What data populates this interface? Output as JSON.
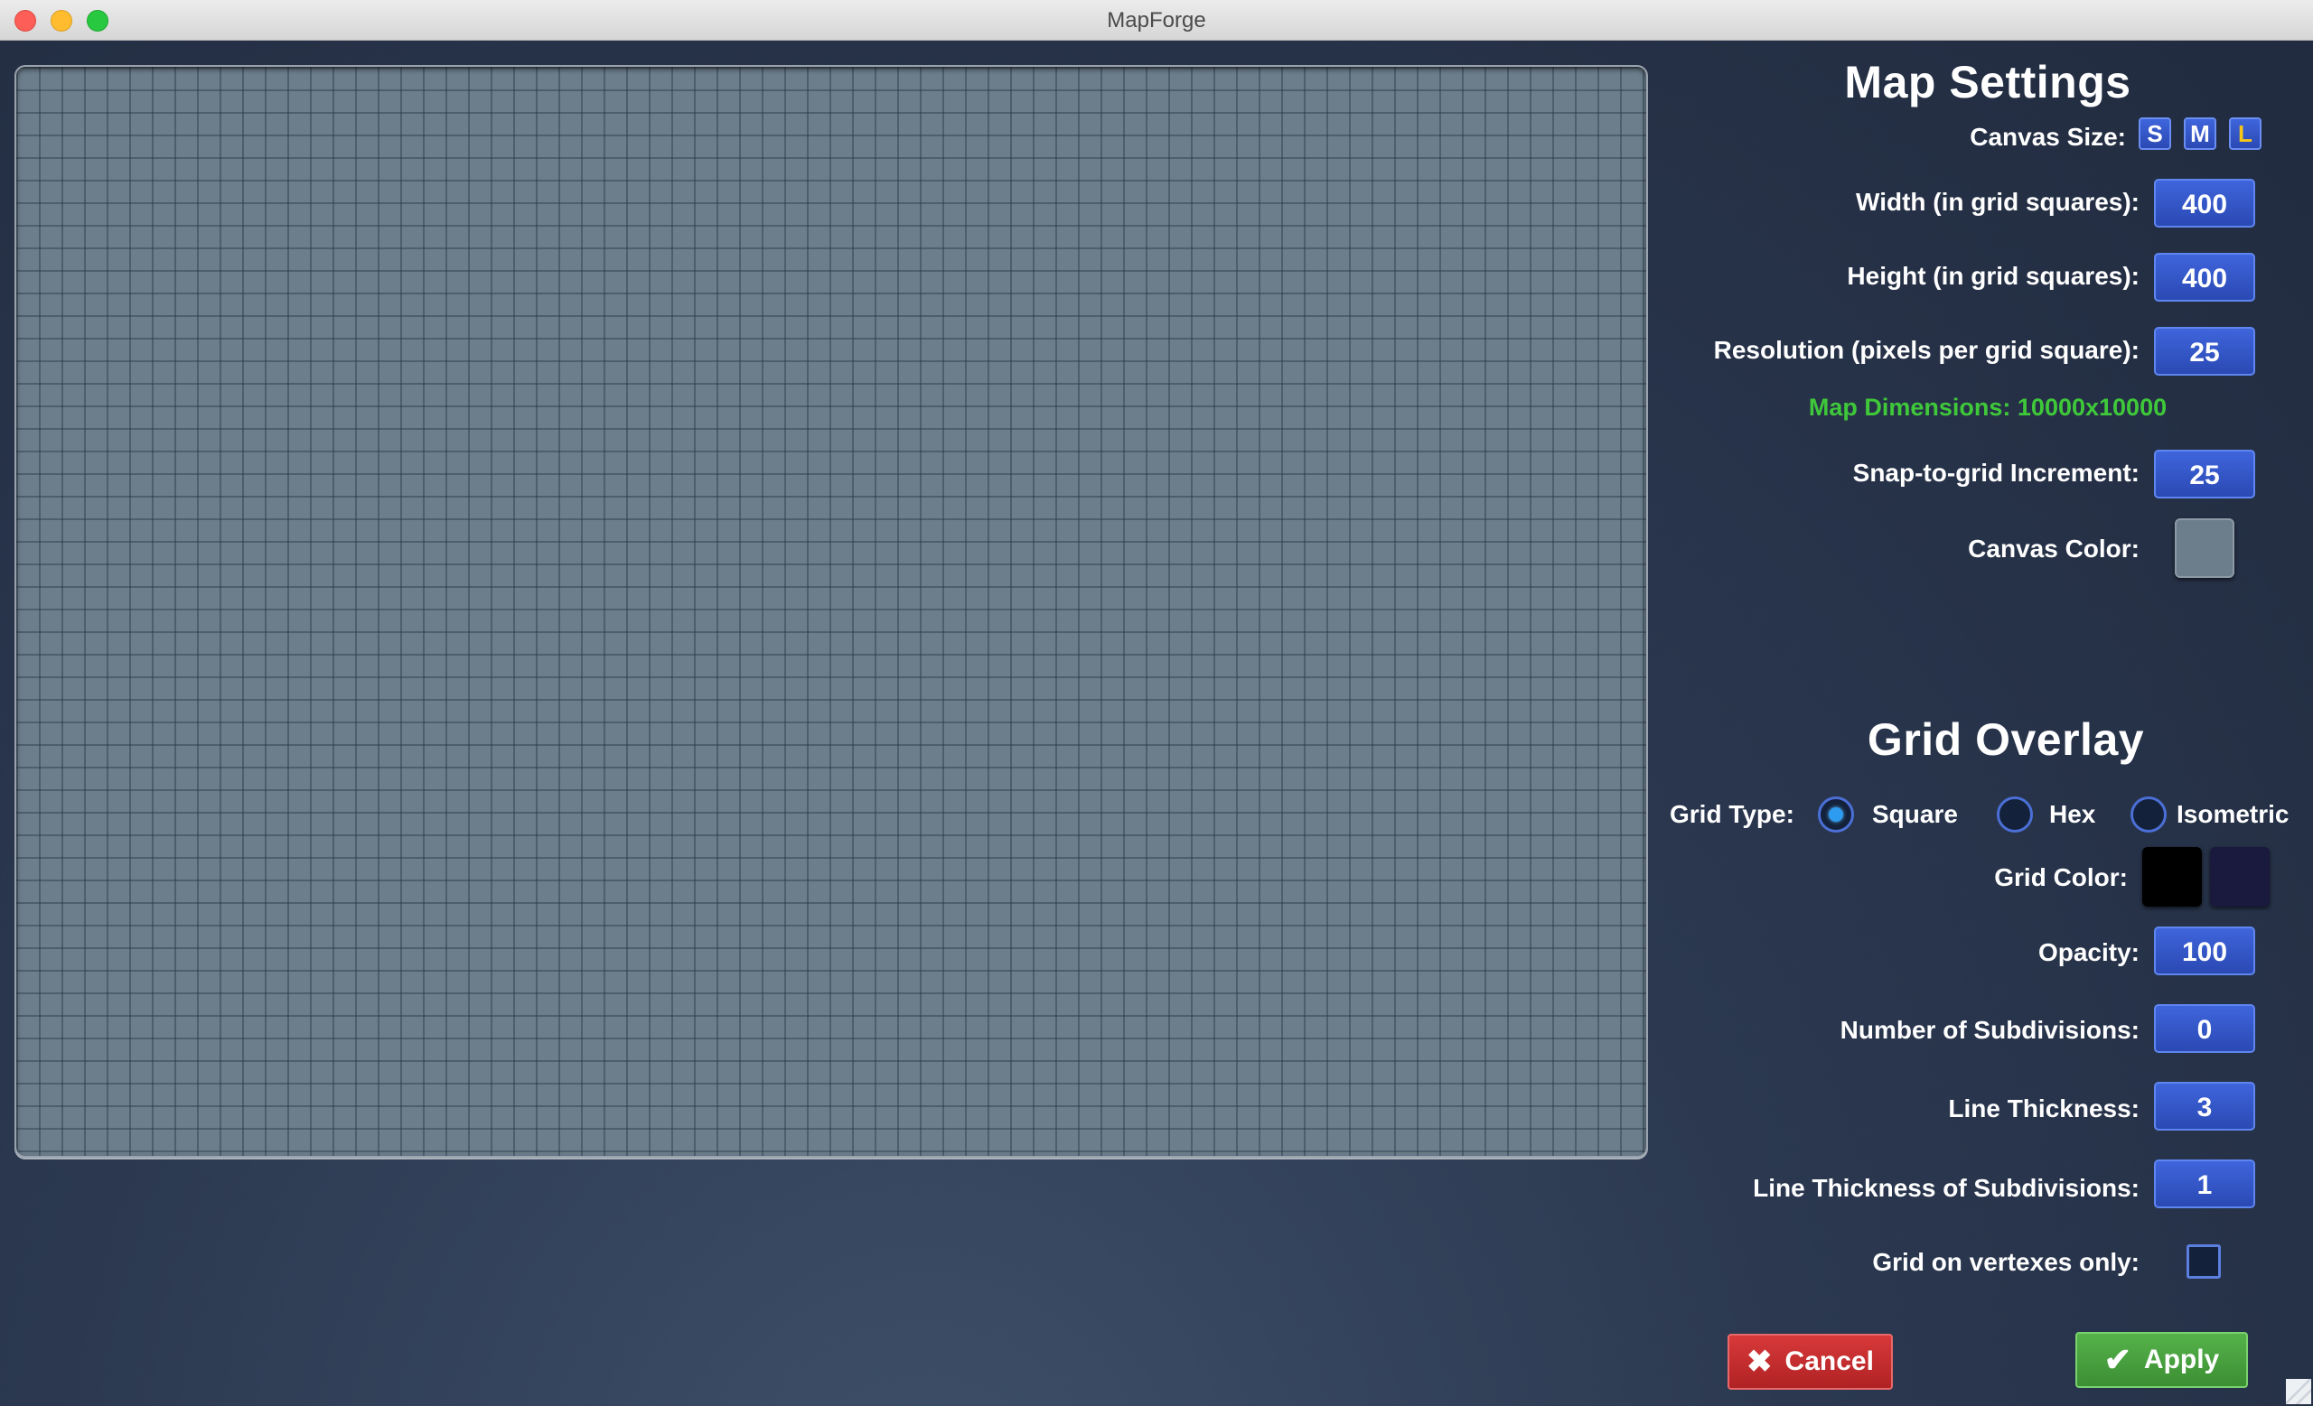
{
  "window": {
    "title": "MapForge"
  },
  "map_settings": {
    "heading": "Map Settings",
    "canvas_size_label": "Canvas Size:",
    "canvas_size_options": [
      "S",
      "M",
      "L"
    ],
    "canvas_size_selected": "L",
    "width_label": "Width (in grid squares):",
    "width_value": "400",
    "height_label": "Height (in grid squares):",
    "height_value": "400",
    "resolution_label": "Resolution (pixels per grid square):",
    "resolution_value": "25",
    "dimensions_text": "Map Dimensions: 10000x10000",
    "snap_label": "Snap-to-grid Increment:",
    "snap_value": "25",
    "canvas_color_label": "Canvas Color:",
    "canvas_color": "#6c7d8c"
  },
  "grid_overlay": {
    "heading": "Grid Overlay",
    "grid_type_label": "Grid Type:",
    "grid_types": [
      "Square",
      "Hex",
      "Isometric"
    ],
    "grid_type_selected": "Square",
    "grid_color_label": "Grid Color:",
    "grid_colors": [
      "#000000",
      "#1a1a3e"
    ],
    "opacity_label": "Opacity:",
    "opacity_value": "100",
    "subdivisions_label": "Number of Subdivisions:",
    "subdivisions_value": "0",
    "line_thickness_label": "Line Thickness:",
    "line_thickness_value": "3",
    "sub_line_thickness_label": "Line Thickness of Subdivisions:",
    "sub_line_thickness_value": "1",
    "vertex_only_label": "Grid on vertexes only:",
    "vertex_only_checked": false
  },
  "actions": {
    "cancel_label": "Cancel",
    "apply_label": "Apply"
  },
  "colors": {
    "accent_blue": "#2f52c4",
    "dimensions_green": "#3fc83a",
    "cancel_red": "#c52c2e",
    "apply_green": "#4aa13f"
  }
}
